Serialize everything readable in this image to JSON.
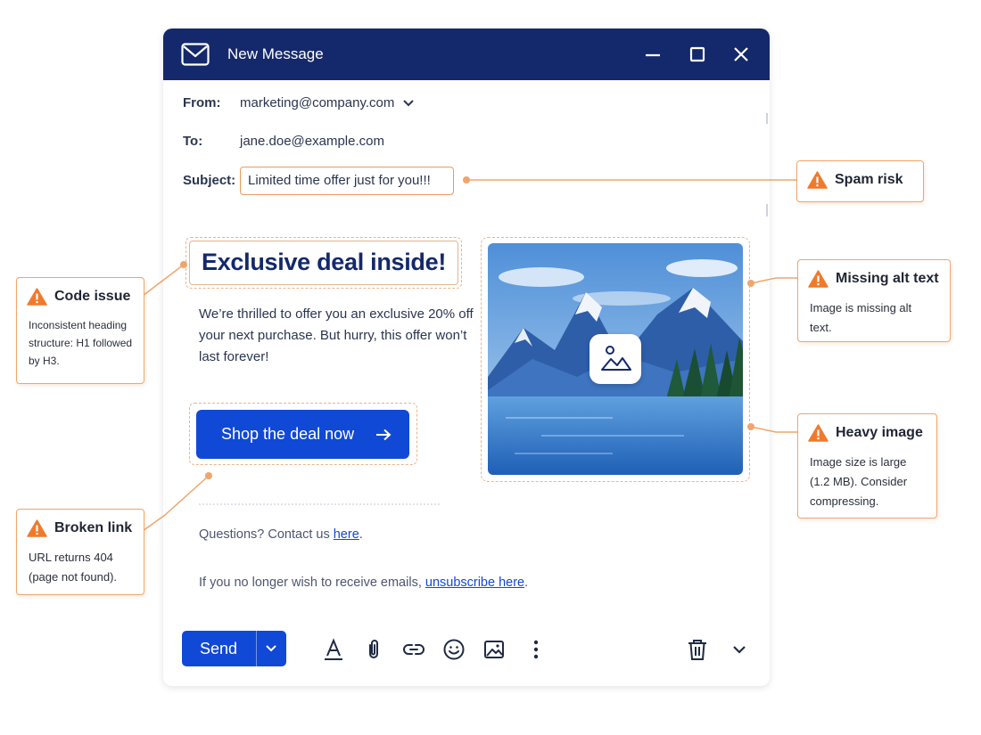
{
  "window": {
    "title": "New Message",
    "titlebar_color": "#14296b"
  },
  "header": {
    "from_label": "From:",
    "from_value": "marketing@company.com",
    "to_label": "To:",
    "to_value": "jane.doe@example.com",
    "subject_label": "Subject:",
    "subject_value": "Limited time offer just for you!!!"
  },
  "content": {
    "heading": "Exclusive deal inside!",
    "body": "We’re thrilled to offer you an exclusive 20% off your next purchase. But hurry, this offer won’t last forever!",
    "cta_label": "Shop the deal now",
    "footer_contact_prefix": "Questions? Contact us ",
    "footer_contact_link": "here",
    "footer_contact_suffix": ".",
    "footer_unsub_prefix": "If you no longer wish to receive emails, ",
    "footer_unsub_link": "unsubscribe here",
    "footer_unsub_suffix": "."
  },
  "toolbar": {
    "send_label": "Send",
    "accent_color": "#1049d6",
    "icons": [
      "text-format-icon",
      "attachment-icon",
      "link-icon",
      "emoji-icon",
      "image-icon",
      "more-options-icon",
      "delete-icon",
      "chevron-down-icon"
    ]
  },
  "callouts": {
    "spam": {
      "title": "Spam risk"
    },
    "code": {
      "title": "Code issue",
      "description": "Inconsistent heading structure: H1 followed by H3."
    },
    "alt": {
      "title": "Missing alt text",
      "description": "Image is missing alt text."
    },
    "heavy": {
      "title": "Heavy image",
      "description": "Image size is large (1.2 MB). Consider compressing."
    },
    "broken": {
      "title": "Broken link",
      "description": "URL returns 404 (page not found)."
    },
    "border_color": "#f0a56c",
    "warning_color": "#f07a2c"
  }
}
